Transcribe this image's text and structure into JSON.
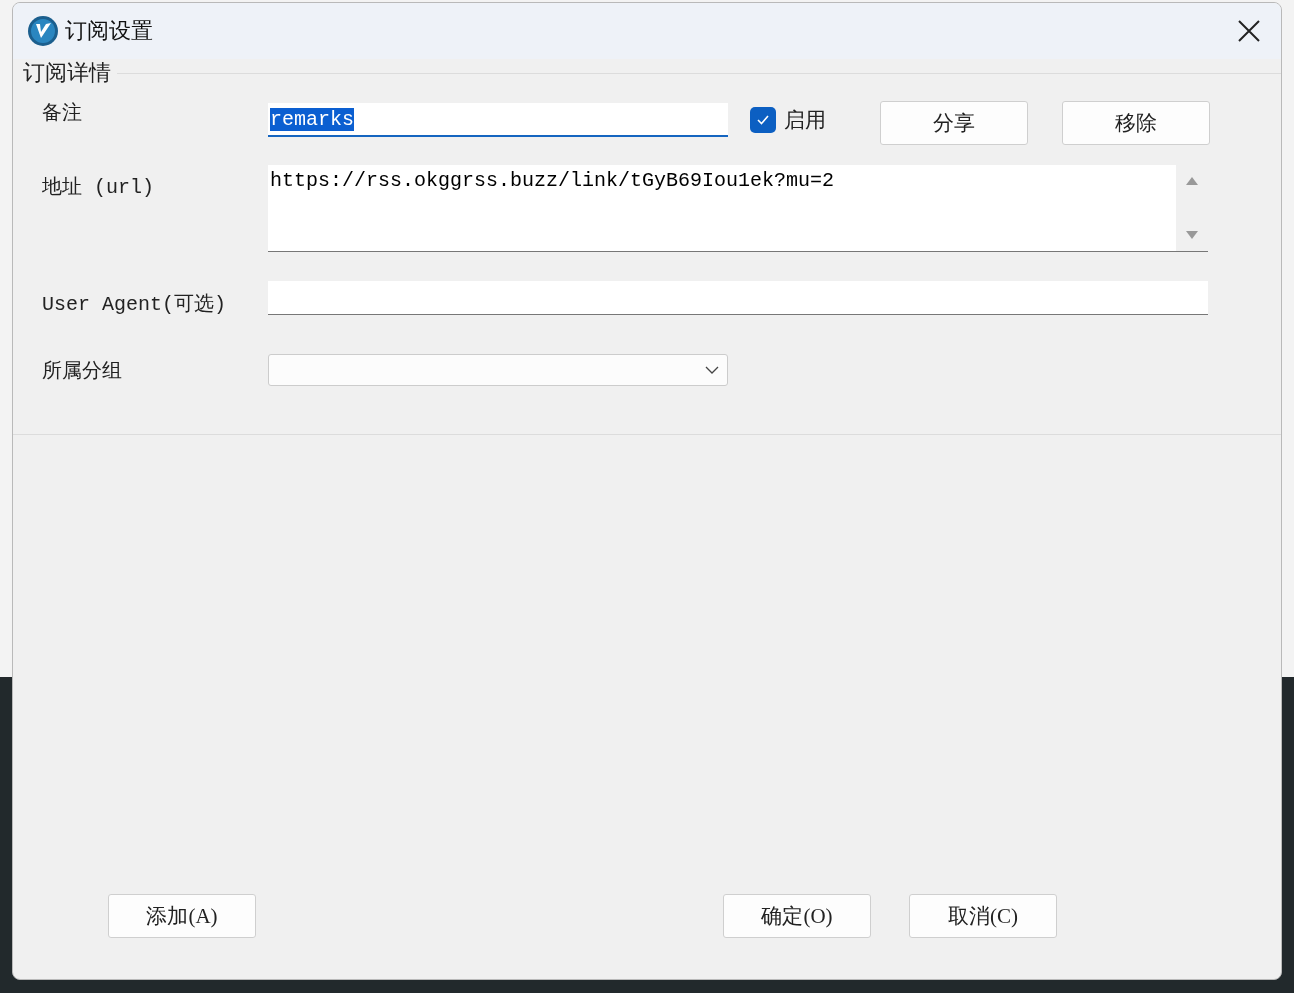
{
  "window": {
    "title": "订阅设置"
  },
  "group_box": {
    "title": "订阅详情"
  },
  "remarks": {
    "label": "备注",
    "value": "remarks",
    "text_selected": true
  },
  "enabled": {
    "label": "启用",
    "checked": true
  },
  "top_buttons": [
    {
      "label": "分享"
    },
    {
      "label": "移除"
    }
  ],
  "url": {
    "label": "地址 (url)",
    "value": "https://rss.okggrss.buzz/link/tGyB69Iou1ek?mu=2"
  },
  "user_agent": {
    "label": "User Agent(可选)"
  },
  "group": {
    "label": "所属分组"
  },
  "footer_left_buttons": [
    {
      "label": "添加(A)"
    }
  ],
  "footer_right_buttons": [
    {
      "label": "确定(O)"
    },
    {
      "label": "取消(C)"
    }
  ]
}
